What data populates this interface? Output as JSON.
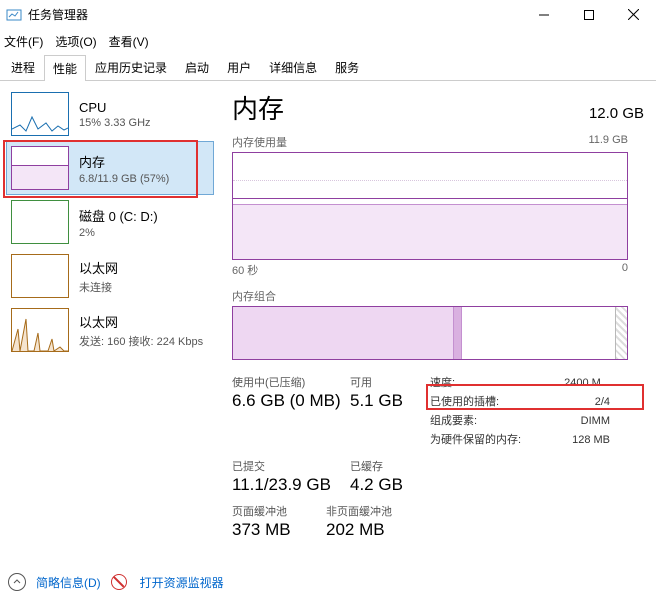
{
  "window": {
    "title": "任务管理器"
  },
  "menu": {
    "file": "文件(F)",
    "options": "选项(O)",
    "view": "查看(V)"
  },
  "tabs": [
    "进程",
    "性能",
    "应用历史记录",
    "启动",
    "用户",
    "详细信息",
    "服务"
  ],
  "active_tab": 1,
  "sidebar": [
    {
      "name": "CPU",
      "sub": "15% 3.33 GHz"
    },
    {
      "name": "内存",
      "sub": "6.8/11.9 GB (57%)"
    },
    {
      "name": "磁盘 0 (C: D:)",
      "sub": "2%"
    },
    {
      "name": "以太网",
      "sub": "未连接"
    },
    {
      "name": "以太网",
      "sub": "发送: 160 接收: 224 Kbps"
    }
  ],
  "main": {
    "title": "内存",
    "total": "12.0 GB",
    "usage_label": "内存使用量",
    "usage_max": "11.9 GB",
    "x_left": "60 秒",
    "x_right": "0",
    "compose_label": "内存组合",
    "stats": {
      "in_use_label": "使用中(已压缩)",
      "in_use": "6.6 GB (0 MB)",
      "avail_label": "可用",
      "avail": "5.1 GB",
      "committed_label": "已提交",
      "committed": "11.1/23.9 GB",
      "cached_label": "已缓存",
      "cached": "4.2 GB",
      "paged_label": "页面缓冲池",
      "paged": "373 MB",
      "nonpaged_label": "非页面缓冲池",
      "nonpaged": "202 MB"
    },
    "right": {
      "speed_label": "速度:",
      "speed": "2400 M...",
      "slots_label": "已使用的插槽:",
      "slots": "2/4",
      "form_label": "组成要素:",
      "form": "DIMM",
      "reserved_label": "为硬件保留的内存:",
      "reserved": "128 MB"
    }
  },
  "footer": {
    "brief": "简略信息(D)",
    "resmon": "打开资源监视器"
  }
}
